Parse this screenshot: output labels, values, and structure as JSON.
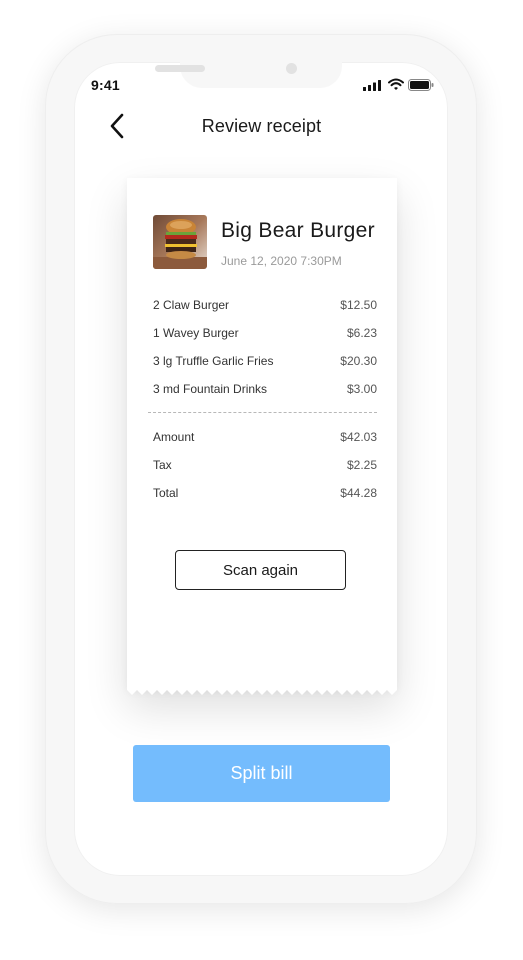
{
  "status_bar": {
    "time": "9:41"
  },
  "header": {
    "title": "Review receipt",
    "back_icon": "chevron-left-icon"
  },
  "receipt": {
    "restaurant_name": "Big Bear Burger",
    "date": "June 12, 2020 7:30PM",
    "items": [
      {
        "label": "2 Claw Burger",
        "price": "$12.50"
      },
      {
        "label": "1 Wavey Burger",
        "price": "$6.23"
      },
      {
        "label": "3 lg Truffle Garlic Fries",
        "price": "$20.30"
      },
      {
        "label": "3 md Fountain Drinks",
        "price": "$3.00"
      }
    ],
    "summary": [
      {
        "label": "Amount",
        "price": "$42.03"
      },
      {
        "label": "Tax",
        "price": "$2.25"
      },
      {
        "label": "Total",
        "price": "$44.28"
      }
    ],
    "scan_again_label": "Scan again"
  },
  "footer": {
    "split_bill_label": "Split bill"
  },
  "colors": {
    "primary": "#74bcfd",
    "text": "#1a1a1a",
    "muted": "#9a9a9a"
  }
}
